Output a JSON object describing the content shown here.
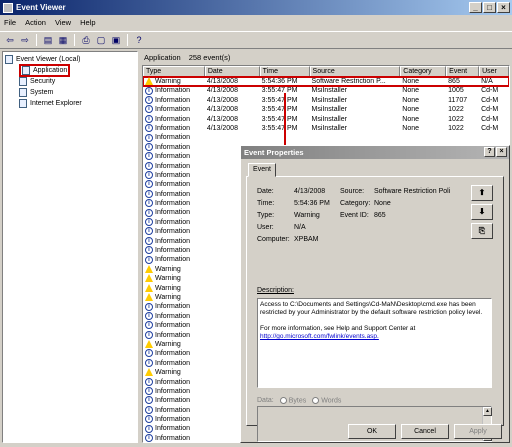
{
  "window": {
    "title": "Event Viewer",
    "controls": [
      "_",
      "□",
      "×"
    ]
  },
  "menu": [
    "File",
    "Action",
    "View",
    "Help"
  ],
  "toolbar": [
    "⇦",
    "⇨",
    "▤",
    "▦",
    "⎙",
    "▢",
    "▣",
    "?"
  ],
  "tree": {
    "root": "Event Viewer (Local)",
    "items": [
      {
        "label": "Application",
        "selected": true
      },
      {
        "label": "Security"
      },
      {
        "label": "System"
      },
      {
        "label": "Internet Explorer"
      }
    ]
  },
  "list": {
    "header_title": "Application",
    "header_count": "258 event(s)",
    "columns": [
      "Type",
      "Date",
      "Time",
      "Source",
      "Category",
      "Event",
      "User"
    ],
    "rows": [
      {
        "type": "Warning",
        "icon": "warning",
        "date": "4/13/2008",
        "time": "5:54:36 PM",
        "source": "Software Restriction P...",
        "category": "None",
        "event": "865",
        "user": "N/A",
        "selected": true
      },
      {
        "type": "Information",
        "icon": "info",
        "date": "4/13/2008",
        "time": "3:55:47 PM",
        "source": "MsiInstaller",
        "category": "None",
        "event": "1005",
        "user": "Cd-M"
      },
      {
        "type": "Information",
        "icon": "info",
        "date": "4/13/2008",
        "time": "3:55:47 PM",
        "source": "MsiInstaller",
        "category": "None",
        "event": "11707",
        "user": "Cd-M"
      },
      {
        "type": "Information",
        "icon": "info",
        "date": "4/13/2008",
        "time": "3:55:47 PM",
        "source": "MsiInstaller",
        "category": "None",
        "event": "1022",
        "user": "Cd-M"
      },
      {
        "type": "Information",
        "icon": "info",
        "date": "4/13/2008",
        "time": "3:55:47 PM",
        "source": "MsiInstaller",
        "category": "None",
        "event": "1022",
        "user": "Cd-M"
      },
      {
        "type": "Information",
        "icon": "info",
        "date": "4/13/2008",
        "time": "3:55:47 PM",
        "source": "MsiInstaller",
        "category": "None",
        "event": "1022",
        "user": "Cd-M"
      },
      {
        "type": "Information",
        "icon": "info"
      },
      {
        "type": "Information",
        "icon": "info"
      },
      {
        "type": "Information",
        "icon": "info"
      },
      {
        "type": "Information",
        "icon": "info"
      },
      {
        "type": "Information",
        "icon": "info"
      },
      {
        "type": "Information",
        "icon": "info"
      },
      {
        "type": "Information",
        "icon": "info"
      },
      {
        "type": "Information",
        "icon": "info"
      },
      {
        "type": "Information",
        "icon": "info"
      },
      {
        "type": "Information",
        "icon": "info"
      },
      {
        "type": "Information",
        "icon": "info"
      },
      {
        "type": "Information",
        "icon": "info"
      },
      {
        "type": "Information",
        "icon": "info"
      },
      {
        "type": "Information",
        "icon": "info"
      },
      {
        "type": "Warning",
        "icon": "warning"
      },
      {
        "type": "Warning",
        "icon": "warning"
      },
      {
        "type": "Warning",
        "icon": "warning"
      },
      {
        "type": "Warning",
        "icon": "warning"
      },
      {
        "type": "Information",
        "icon": "info"
      },
      {
        "type": "Information",
        "icon": "info"
      },
      {
        "type": "Information",
        "icon": "info"
      },
      {
        "type": "Information",
        "icon": "info"
      },
      {
        "type": "Warning",
        "icon": "warning"
      },
      {
        "type": "Information",
        "icon": "info"
      },
      {
        "type": "Information",
        "icon": "info"
      },
      {
        "type": "Warning",
        "icon": "warning"
      },
      {
        "type": "Information",
        "icon": "info"
      },
      {
        "type": "Information",
        "icon": "info"
      },
      {
        "type": "Information",
        "icon": "info"
      },
      {
        "type": "Information",
        "icon": "info"
      },
      {
        "type": "Information",
        "icon": "info"
      },
      {
        "type": "Information",
        "icon": "info"
      },
      {
        "type": "Information",
        "icon": "info"
      }
    ]
  },
  "dialog": {
    "title": "Event Properties",
    "controls": [
      "?",
      "×"
    ],
    "tab": "Event",
    "date_label": "Date:",
    "date_value": "4/13/2008",
    "time_label": "Time:",
    "time_value": "5:54:36 PM",
    "type_label": "Type:",
    "type_value": "Warning",
    "user_label": "User:",
    "user_value": "N/A",
    "computer_label": "Computer:",
    "computer_value": "XPBAM",
    "source_label": "Source:",
    "source_value": "Software Restriction Poli",
    "category_label": "Category:",
    "category_value": "None",
    "eventid_label": "Event ID:",
    "eventid_value": "865",
    "up_button": "⬆",
    "down_button": "⬇",
    "copy_button": "⎘",
    "description_label": "Description:",
    "description_text": "Access to C:\\Documents and Settings\\Cd-MaN\\Desktop\\cmd.exe has been restricted by your Administrator by the default software restriction policy level.",
    "description_more": "For more information, see Help and Support Center at",
    "description_link": "http://go.microsoft.com/fwlink/events.asp.",
    "data_label": "Data:",
    "bytes_label": "Bytes",
    "words_label": "Words",
    "ok": "OK",
    "cancel": "Cancel",
    "apply": "Apply"
  }
}
